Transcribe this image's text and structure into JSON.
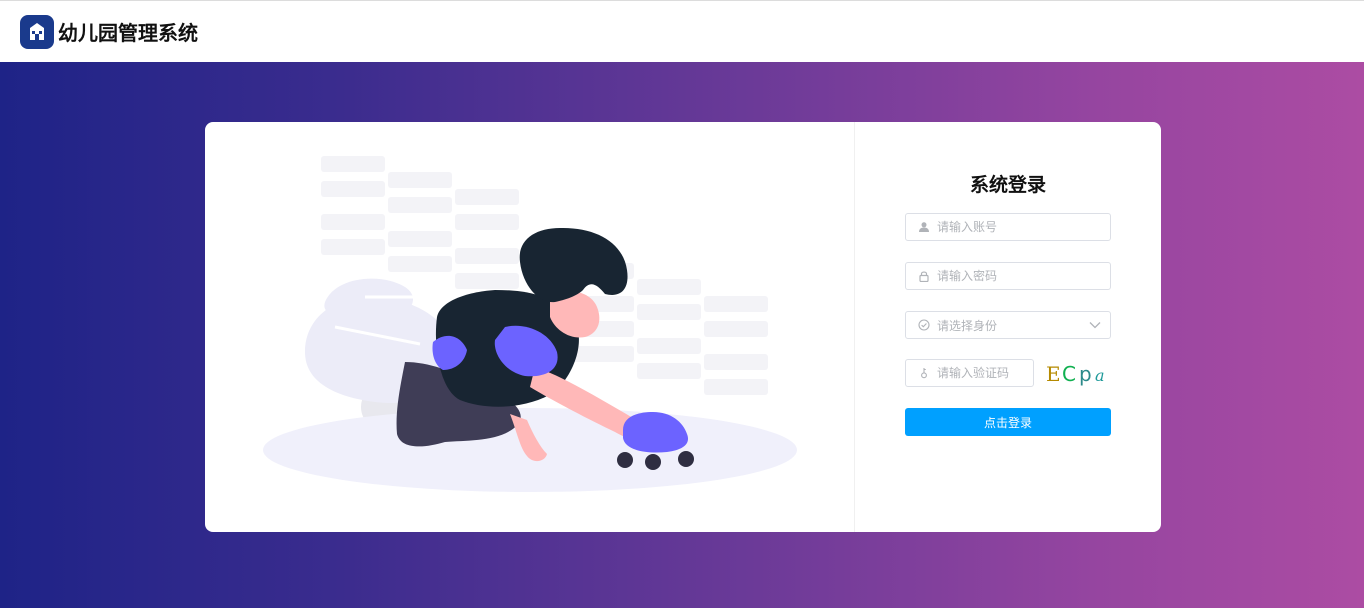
{
  "app": {
    "title": "幼儿园管理系统",
    "logo_icon": "school-building-icon",
    "brand_color": "#1a3a8c"
  },
  "login": {
    "title": "系统登录",
    "username": {
      "placeholder": "请输入账号",
      "icon": "user-icon"
    },
    "password": {
      "placeholder": "请输入密码",
      "icon": "lock-icon"
    },
    "role": {
      "placeholder": "请选择身份",
      "icon": "check-circle-icon",
      "chevron": "chevron-down-icon"
    },
    "captcha": {
      "placeholder": "请输入验证码",
      "icon": "key-icon",
      "image_text": "ECpa"
    },
    "submit_label": "点击登录",
    "button_color": "#00a0ff"
  },
  "background": {
    "gradient_start": "#1e2387",
    "gradient_end": "#ac4ca3"
  },
  "illustration": {
    "subject": "child-playing-with-toy-car-illustration"
  }
}
